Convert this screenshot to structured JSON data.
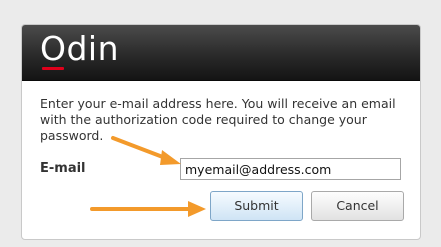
{
  "header": {
    "logo_text": "Odin"
  },
  "form": {
    "message": "Enter your e-mail address here. You will receive an email with the authorization code required to change your password.",
    "email_label": "E-mail",
    "email_value": "myemail@address.com",
    "submit_label": "Submit",
    "cancel_label": "Cancel"
  },
  "colors": {
    "annotation_arrow": "#f39a2b",
    "logo_accent": "#e0001b"
  }
}
